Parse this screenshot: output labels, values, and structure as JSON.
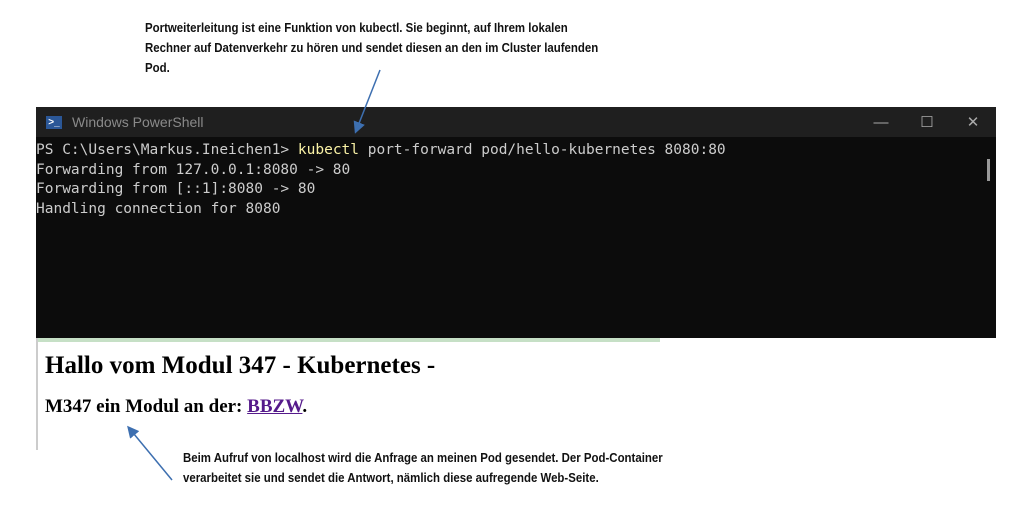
{
  "annotations": {
    "top": [
      "Portweiterleitung ist eine Funktion von kubectl. Sie beginnt, auf Ihrem lokalen",
      "Rechner auf Datenverkehr zu hören und sendet diesen an den im Cluster laufenden",
      "Pod."
    ],
    "bottom": [
      "Beim Aufruf von localhost wird die Anfrage an meinen Pod gesendet. Der Pod-Container",
      "verarbeitet sie und sendet die Antwort, nämlich diese aufregende Web-Seite."
    ]
  },
  "terminal": {
    "title": "Windows PowerShell",
    "prompt": "PS C:\\Users\\Markus.Ineichen1> ",
    "command": "kubectl",
    "args": " port-forward pod/hello-kubernetes 8080:80",
    "output": [
      "Forwarding from 127.0.0.1:8080 -> 80",
      "Forwarding from [::1]:8080 -> 80",
      "Handling connection for 8080"
    ]
  },
  "webpage": {
    "heading": "Hallo vom Modul 347 - Kubernetes -",
    "subheading_prefix": "M347 ein Modul an der: ",
    "link": "BBZW",
    "suffix": "."
  }
}
